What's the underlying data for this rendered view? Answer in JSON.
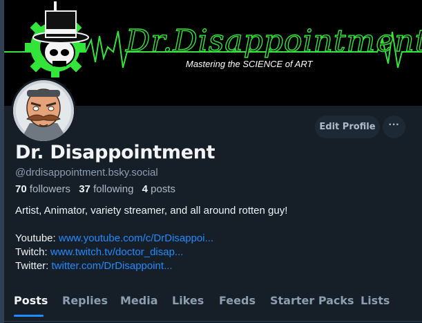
{
  "banner": {
    "script_title": "Dr.Disappointment",
    "tagline": "Mastering the SCIENCE of ART",
    "accent": "#33e43a"
  },
  "profile": {
    "display_name": "Dr. Disappointment",
    "handle": "@drdisappointment.bsky.social",
    "stats": {
      "followers_count": "70",
      "followers_label": "followers",
      "following_count": "37",
      "following_label": "following",
      "posts_count": "4",
      "posts_label": "posts"
    },
    "bio": {
      "line1": "Artist, Animator, variety streamer, and all around rotten guy!",
      "links": [
        {
          "label": "Youtube:",
          "url": "www.youtube.com/c/DrDisappoi..."
        },
        {
          "label": "Twitch:",
          "url": "www.twitch.tv/doctor_disap..."
        },
        {
          "label": "Twitter:",
          "url": "twitter.com/DrDisappoint..."
        }
      ]
    }
  },
  "actions": {
    "edit_profile_label": "Edit Profile",
    "more_label": "···"
  },
  "tabs": [
    {
      "label": "Posts",
      "active": true
    },
    {
      "label": "Replies",
      "active": false
    },
    {
      "label": "Media",
      "active": false
    },
    {
      "label": "Likes",
      "active": false
    },
    {
      "label": "Feeds",
      "active": false
    },
    {
      "label": "Starter Packs",
      "active": false
    },
    {
      "label": "Lists",
      "active": false
    }
  ],
  "colors": {
    "background": "#161e27",
    "link": "#208bfe",
    "muted_text": "#8d9eb0",
    "button_bg": "#1e2936"
  },
  "icons": {
    "more": "ellipsis-icon"
  }
}
